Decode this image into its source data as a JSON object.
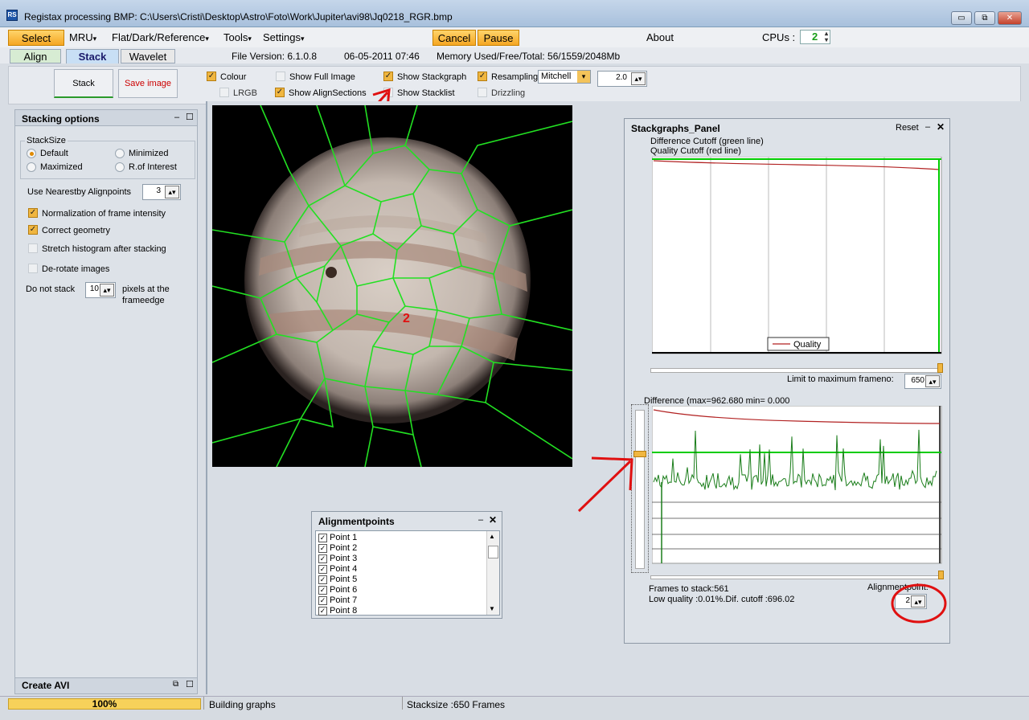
{
  "window": {
    "title": "Registax processing BMP: C:\\Users\\Cristi\\Desktop\\Astro\\Foto\\Work\\Jupiter\\avi98\\Jq0218_RGR.bmp",
    "icon_label": "RS",
    "minimize": "▭",
    "restore": "⧉",
    "close": "✕"
  },
  "menu": {
    "select": "Select",
    "mru": "MRU",
    "flat_dark": "Flat/Dark/Reference",
    "tools": "Tools",
    "settings": "Settings",
    "cancel": "Cancel",
    "pause": "Pause",
    "about": "About",
    "cpus_label": "CPUs :",
    "cpus_value": "2",
    "dropdown_glyph": "▾"
  },
  "tabs": {
    "align": "Align",
    "stack": "Stack",
    "wavelet": "Wavelet"
  },
  "info": {
    "file_version": "File Version: 6.1.0.8",
    "datetime": "06-05-2011 07:46",
    "memory": "Memory Used/Free/Total: 56/1559/2048Mb"
  },
  "toolbar": {
    "stack_button": "Stack",
    "save_image": "Save image",
    "colour": "Colour",
    "lrgb": "LRGB",
    "show_full_image": "Show Full Image",
    "show_alignsections": "Show AlignSections",
    "show_stackgraph": "Show Stackgraph",
    "show_stacklist": "Show Stacklist",
    "resampling": "Resampling",
    "resampling_method": "Mitchell",
    "drizzling": "Drizzling",
    "scale_value": "2.0",
    "check_mark": "✓"
  },
  "stacking_options": {
    "title": "Stacking options",
    "stacksize_label": "StackSize",
    "default": "Default",
    "minimized": "Minimized",
    "maximized": "Maximized",
    "r_of_interest": "R.of Interest",
    "nearest_label": "Use Nearestby Alignpoints",
    "nearest_value": "3",
    "normalization": "Normalization of frame intensity",
    "correct_geometry": "Correct geometry",
    "stretch_histogram": "Stretch histogram after stacking",
    "derotate": "De-rotate images",
    "do_not_stack": "Do not stack",
    "edge_value": "10",
    "edge_suffix_1": "pixels at the",
    "edge_suffix_2": "frameedge",
    "create_avi": "Create AVI",
    "panel_min": "–",
    "panel_max": "☐"
  },
  "image": {
    "marker_label": "2"
  },
  "stackgraphs": {
    "title": "Stackgraphs_Panel",
    "reset": "Reset",
    "diff_cutoff_label": "Difference Cutoff (green line)",
    "quality_cutoff_label": "Quality Cutoff (red line)",
    "legend_quality": "Quality",
    "limit_label": "Limit to maximum frameno:",
    "limit_value": "650",
    "difference_label": "Difference (max=962.680 min= 0.000",
    "frames_to_stack": "Frames to stack:561",
    "low_quality": "Low quality :0.01%.Dif. cutoff  :696.02",
    "alignmentpoint_label": "Alignmentpoint:",
    "alignmentpoint_value": "2",
    "quality_color": "#b22222",
    "cutoff_color": "#00cc00"
  },
  "alignmentpoints": {
    "title": "Alignmentpoints",
    "items": [
      "Point 1",
      "Point 2",
      "Point 3",
      "Point 4",
      "Point 5",
      "Point 6",
      "Point 7",
      "Point 8"
    ]
  },
  "status": {
    "progress_text": "100%",
    "progress_value": 1.0,
    "message": "Building graphs",
    "stacksize": "Stacksize :650 Frames"
  }
}
